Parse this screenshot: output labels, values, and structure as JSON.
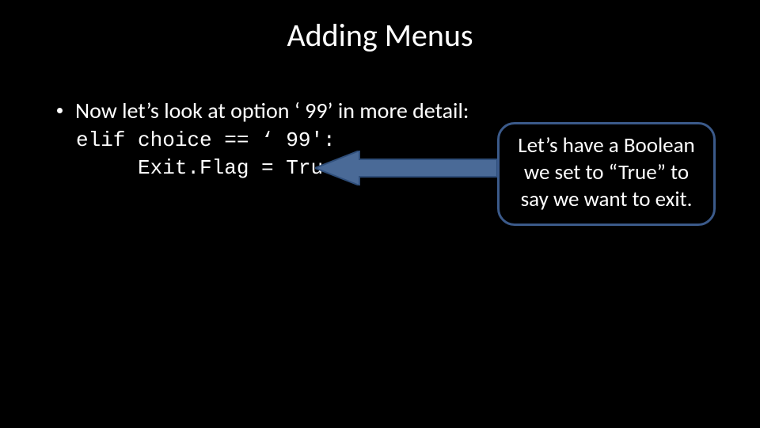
{
  "title": "Adding Menus",
  "bullet": "Now let’s look at option ‘ 99’ in more detail:",
  "code": {
    "line1": "elif choice == ‘ 99':",
    "line2": "     Exit.Flag = True"
  },
  "callout": "Let’s have a Boolean we set to “True” to say we want to exit.",
  "colors": {
    "arrow_fill": "#4a6a97",
    "arrow_stroke": "#2f4e7a",
    "callout_border": "#3b5a8a"
  }
}
